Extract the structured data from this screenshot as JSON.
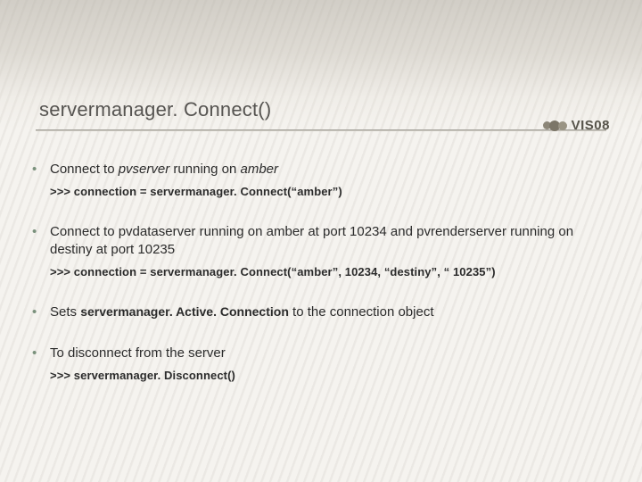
{
  "title": "servermanager. Connect()",
  "logo": {
    "text": "VIS08"
  },
  "bullets": [
    {
      "text_before": "Connect to ",
      "italic1": "pvserver",
      "text_mid": " running on ",
      "italic2": "amber",
      "text_after": "",
      "code": ">>> connection = servermanager. Connect(“amber”)"
    },
    {
      "text_before": "Connect to pvdataserver running on amber at port 10234 and pvrenderserver running on destiny at port 10235",
      "italic1": "",
      "text_mid": "",
      "italic2": "",
      "text_after": "",
      "code": ">>> connection = servermanager. Connect(“amber”, 10234, “destiny”, “ 10235”)"
    },
    {
      "text_before": "Sets ",
      "inline_bold": "servermanager. Active. Connection",
      "text_after": " to the connection object",
      "code": ""
    },
    {
      "text_before": "To disconnect from the server",
      "italic1": "",
      "text_mid": "",
      "italic2": "",
      "text_after": "",
      "code": ">>> servermanager. Disconnect()"
    }
  ]
}
